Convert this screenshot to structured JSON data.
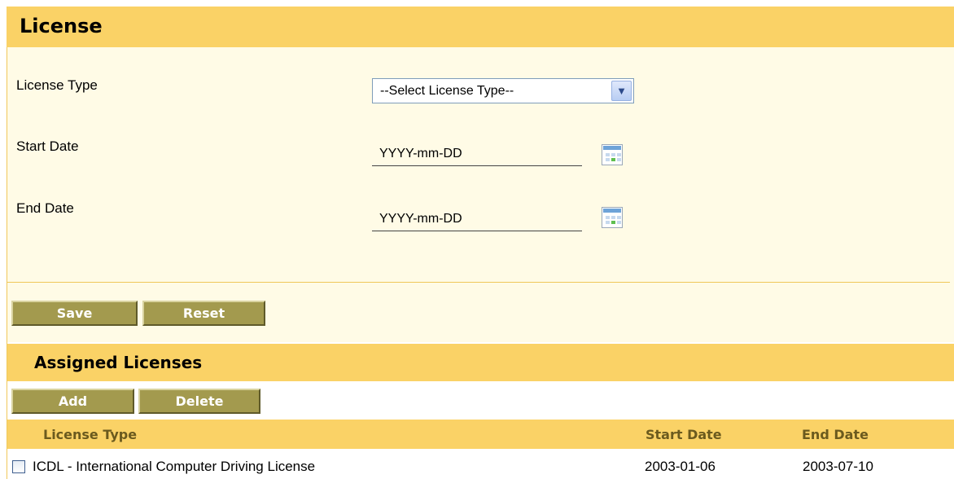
{
  "header": {
    "title": "License"
  },
  "form": {
    "license_type_label": "License Type",
    "license_type_value": "--Select License Type--",
    "start_date_label": "Start Date",
    "start_date_value": "YYYY-mm-DD",
    "end_date_label": "End Date",
    "end_date_value": "YYYY-mm-DD",
    "calendar_icon": "calendar-icon",
    "dropdown_icon": "chevron-down-icon"
  },
  "actions": {
    "save_label": "Save",
    "reset_label": "Reset"
  },
  "assigned": {
    "title": "Assigned Licenses",
    "add_label": "Add",
    "delete_label": "Delete",
    "columns": {
      "license_type": "License Type",
      "start_date": "Start Date",
      "end_date": "End Date"
    },
    "rows": [
      {
        "license_type": "ICDL - International Computer Driving License",
        "start_date": "2003-01-06",
        "end_date": "2003-07-10"
      }
    ]
  },
  "colors": {
    "header_bg": "#fad266",
    "form_bg": "#fffbe6",
    "button_bg": "#a39a4e",
    "column_text": "#6b5a1e"
  }
}
